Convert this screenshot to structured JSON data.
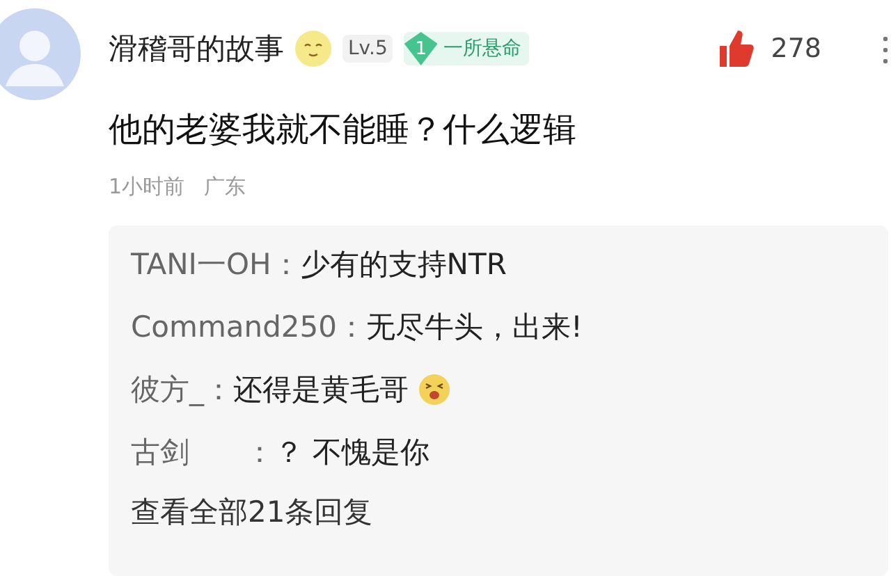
{
  "comment": {
    "author": "滑稽哥的故事",
    "level": "Lv.5",
    "badge": {
      "number": "1",
      "label": "一所悬命"
    },
    "likes": "278",
    "text": "他的老婆我就不能睡？什么逻辑",
    "time": "1小时前",
    "location": "广东"
  },
  "replies": [
    {
      "name": "TANI一OH",
      "sep": "：",
      "text": "少有的支持NTR",
      "emoji": false
    },
    {
      "name": "Command250",
      "sep": "：",
      "text": "无尽牛头，出来!",
      "emoji": false
    },
    {
      "name": "彼方_",
      "sep": "：",
      "text": "还得是黄毛哥",
      "emoji": true
    },
    {
      "name": "古剑      ",
      "sep": "：",
      "text": "？ 不愧是你",
      "emoji": false
    }
  ],
  "more_replies": "查看全部21条回复"
}
